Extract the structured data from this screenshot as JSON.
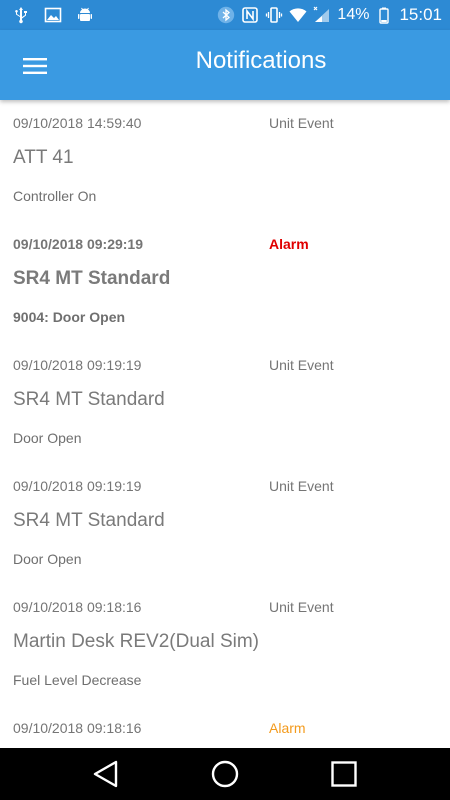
{
  "status_bar": {
    "battery_percent": "14%",
    "time": "15:01",
    "left_icons": [
      "usb-icon",
      "image-icon",
      "android-icon"
    ],
    "right_icons": [
      "bluetooth-icon",
      "nfc-icon",
      "vibrate-icon",
      "wifi-icon",
      "signal-icon",
      "battery-icon"
    ]
  },
  "app_bar": {
    "title": "Notifications",
    "menu_icon": "hamburger-menu-icon",
    "color": "#3a9ae2"
  },
  "notifications": [
    {
      "timestamp": "09/10/2018 14:59:40",
      "type": "Unit Event",
      "device": "ATT 41",
      "description": "Controller On"
    },
    {
      "timestamp": "09/10/2018 09:29:19",
      "type": "Alarm",
      "device": "SR4 MT Standard",
      "description": "9004: Door Open"
    },
    {
      "timestamp": "09/10/2018 09:19:19",
      "type": "Unit Event",
      "device": "SR4 MT Standard",
      "description": "Door Open"
    },
    {
      "timestamp": "09/10/2018 09:19:19",
      "type": "Unit Event",
      "device": "SR4 MT Standard",
      "description": "Door Open"
    },
    {
      "timestamp": "09/10/2018 09:18:16",
      "type": "Unit Event",
      "device": "Martin Desk REV2(Dual Sim)",
      "description": "Fuel Level Decrease"
    },
    {
      "timestamp": "09/10/2018 09:18:16",
      "type": "Alarm",
      "device": "",
      "description": ""
    }
  ],
  "colors": {
    "alarm_active": "#e00000",
    "alarm_other": "#f39a1c",
    "status_bar": "#2d8ad4"
  },
  "nav_bar": {
    "icons": [
      "back-icon",
      "home-icon",
      "recents-icon"
    ]
  }
}
